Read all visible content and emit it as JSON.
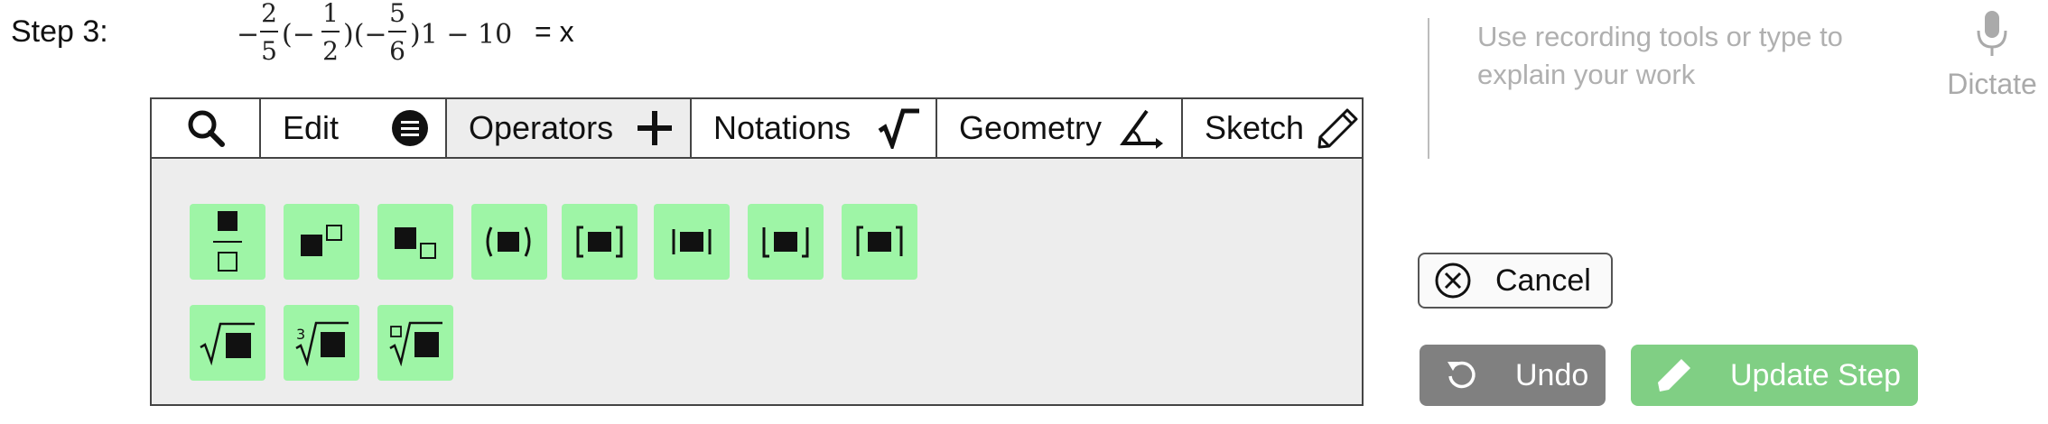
{
  "step": {
    "label": "Step 3:",
    "equation": {
      "frac1_num": "2",
      "frac1_den": "5",
      "frac2_num": "1",
      "frac2_den": "2",
      "frac3_num": "5",
      "frac3_den": "6",
      "tail": ")1 − 10"
    },
    "equals": "= x"
  },
  "editor": {
    "tabs": [
      {
        "label": "",
        "icon": "search-icon"
      },
      {
        "label": "Edit",
        "icon": "menu-icon"
      },
      {
        "label": "Operators",
        "icon": "plus-icon",
        "active": true
      },
      {
        "label": "Notations",
        "icon": "sqrt-icon"
      },
      {
        "label": "Geometry",
        "icon": "angle-icon"
      },
      {
        "label": "Sketch",
        "icon": "pencil-icon"
      }
    ],
    "palette": [
      "fraction",
      "superscript",
      "subscript",
      "parentheses",
      "brackets",
      "absolute-value",
      "floor",
      "ceiling",
      "square-root",
      "cube-root",
      "nth-root"
    ],
    "cube_root_index": "3",
    "accent_color": "#9ef5a6"
  },
  "explain": {
    "placeholder": "Use recording tools or type to explain your work",
    "dictate_label": "Dictate"
  },
  "buttons": {
    "cancel": "Cancel",
    "undo": "Undo",
    "update": "Update Step",
    "undo_color": "#808080",
    "update_color": "#80cf84"
  }
}
